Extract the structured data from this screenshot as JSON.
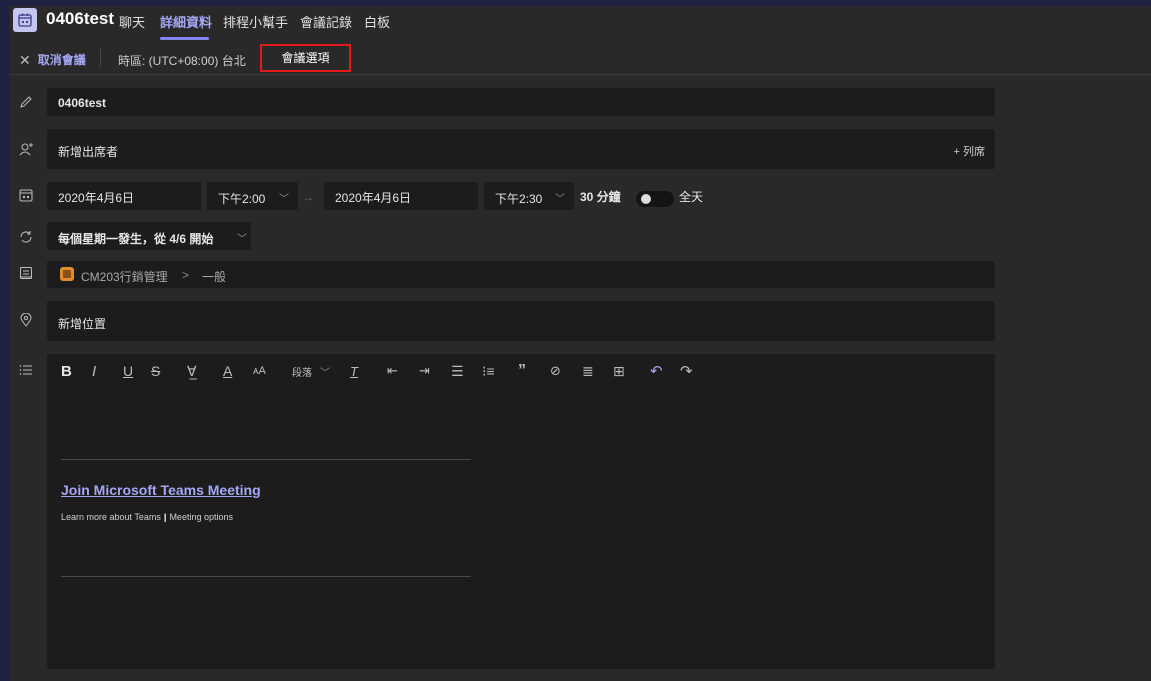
{
  "header": {
    "title": "0406test",
    "tabs": [
      {
        "label": "聊天",
        "active": false
      },
      {
        "label": "詳細資料",
        "active": true
      },
      {
        "label": "排程小幫手",
        "active": false
      },
      {
        "label": "會議記錄",
        "active": false
      },
      {
        "label": "白板",
        "active": false
      }
    ]
  },
  "toolbar": {
    "cancel_label": "取消會議",
    "timezone": "時區: (UTC+08:00) 台北",
    "meeting_options_label": "會議選項"
  },
  "form": {
    "title_value": "0406test",
    "attendees_placeholder": "新增出席者",
    "optional_label": "+ 列席",
    "start_date": "2020年4月6日",
    "start_time": "下午2:00",
    "end_date": "2020年4月6日",
    "end_time": "下午2:30",
    "duration": "30 分鐘",
    "all_day_label": "全天",
    "all_day_on": false,
    "recurrence": "每個星期一發生，從 4/6 開始",
    "channel_team": "CM203行銷管理",
    "channel_sep": ">",
    "channel_name": "一般",
    "location_placeholder": "新增位置"
  },
  "editor": {
    "paragraph_label": "段落",
    "join_link": "Join Microsoft Teams Meeting",
    "learn_more": "Learn more about Teams",
    "separator": "|",
    "meeting_options_link": "Meeting options"
  },
  "colors": {
    "accent": "#7f85f5",
    "highlight_box": "#e21a1a",
    "background": "#292929",
    "field": "#1c1c1c"
  }
}
